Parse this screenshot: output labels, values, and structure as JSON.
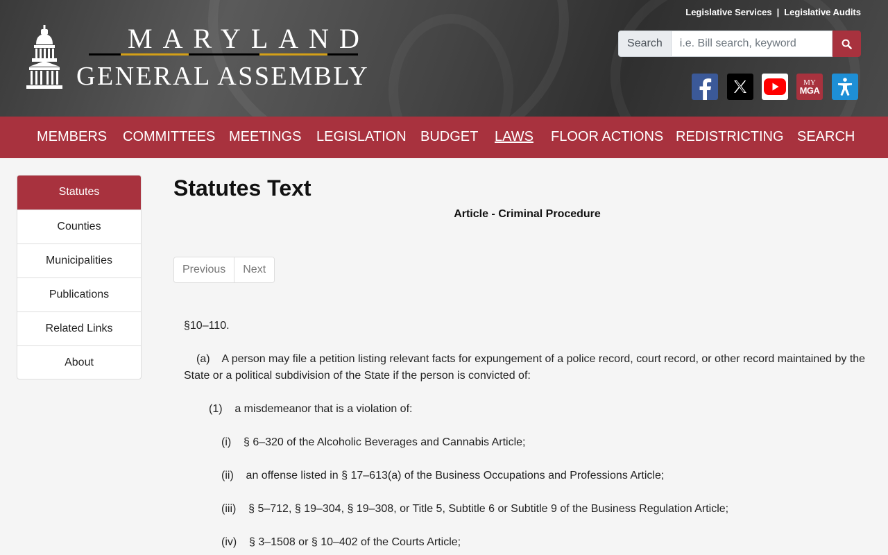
{
  "header": {
    "logo_top": "MARYLAND",
    "logo_bottom": "GENERAL ASSEMBLY",
    "top_links": [
      "Legislative Services",
      "Legislative Audits"
    ],
    "top_links_separator": "|",
    "search": {
      "label": "Search",
      "placeholder": "i.e. Bill search, keyword",
      "button_icon": "search-icon"
    },
    "social": [
      {
        "name": "facebook",
        "icon": "facebook-icon",
        "color": "#3b5998"
      },
      {
        "name": "x",
        "icon": "x-icon",
        "color": "#000000"
      },
      {
        "name": "youtube",
        "icon": "youtube-icon",
        "color": "#ff0000"
      },
      {
        "name": "mymga",
        "icon": "mymga-icon",
        "text_top": "MY",
        "text_bottom": "MGA",
        "color": "#a8323e"
      },
      {
        "name": "accessibility",
        "icon": "accessibility-icon",
        "color": "#1e8fd6"
      }
    ]
  },
  "nav": {
    "items": [
      "MEMBERS",
      "COMMITTEES",
      "MEETINGS",
      "LEGISLATION",
      "BUDGET",
      "LAWS",
      "FLOOR ACTIONS",
      "REDISTRICTING",
      "SEARCH"
    ],
    "active": "LAWS",
    "color": "#a8323e"
  },
  "sidebar": {
    "items": [
      "Statutes",
      "Counties",
      "Municipalities",
      "Publications",
      "Related Links",
      "About"
    ],
    "active": "Statutes"
  },
  "main": {
    "title": "Statutes Text",
    "article": "Article - Criminal Procedure",
    "pager": {
      "previous": "Previous",
      "next": "Next"
    },
    "statute": {
      "section": "§10–110.",
      "lines": [
        "(a)    A person may file a petition listing relevant facts for expungement of a police record, court record, or other record maintained by the State or a political subdivision of the State if the person is convicted of:",
        "(1)    a misdemeanor that is a violation of:",
        "(i)    § 6–320 of the Alcoholic Beverages and Cannabis Article;",
        "(ii)    an offense listed in § 17–613(a) of the Business Occupations and Professions Article;",
        "(iii)    § 5–712, § 19–304, § 19–308, or Title 5, Subtitle 6 or Subtitle 9 of the Business Regulation Article;",
        "(iv)    § 3–1508 or § 10–402 of the Courts Article;"
      ]
    }
  }
}
